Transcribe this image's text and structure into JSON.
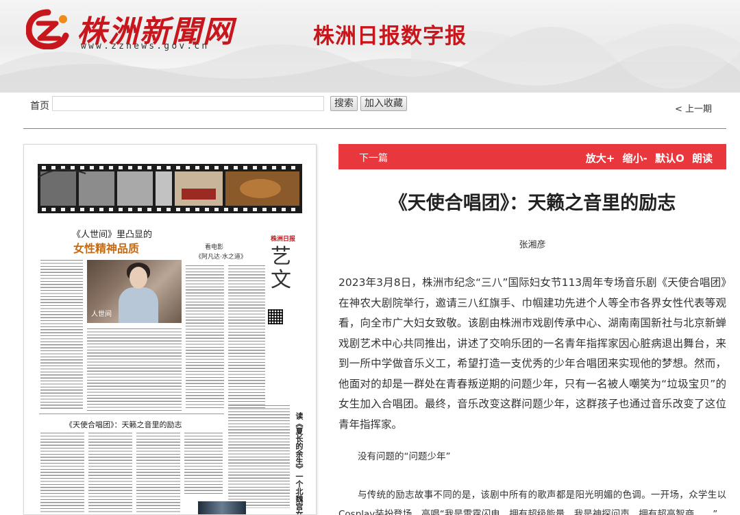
{
  "header": {
    "logo_text": "株洲新聞网",
    "logo_url": "www.zznews.gov.cn",
    "site_title": "株洲日报数字报",
    "colors": {
      "brand_red": "#c8161d",
      "accent_orange": "#f08a1c"
    }
  },
  "toolbar": {
    "home_label": "首页",
    "search_value": "",
    "search_button": "搜索",
    "favorite_button": "加入收藏",
    "prev_issue": "< 上一期"
  },
  "paper": {
    "headline_1": "《人世间》里凸显的",
    "headline_2": "女性精神品质",
    "photo_tag": "人世间",
    "masthead": "株洲日报",
    "section_title": "艺文",
    "sub_1": "看电影",
    "sub_2": "《阿凡达·水之道》",
    "headline_3": "《天使合唱团》：天籁之音里的励志",
    "vertical_title": "读《夏长的余生》一个北魏宫女和她的时代"
  },
  "article": {
    "bar_color": "#e8383d",
    "next_label": "下一篇",
    "tools": [
      "放大+",
      "缩小-",
      "默认O",
      "朗读"
    ],
    "title": "《天使合唱团》：天籁之音里的励志",
    "author": "张湘彦",
    "paragraph_1": "2023年3月8日，株洲市纪念“三八”国际妇女节113周年专场音乐剧《天使合唱团》在神农大剧院举行，邀请三八红旗手、巾帼建功先进个人等全市各界女性代表等观看，向全市广大妇女致敬。该剧由株洲市戏剧传承中心、湖南南国新社与北京新蝉戏剧艺术中心共同推出，讲述了交响乐团的一名青年指挥家因心脏病退出舞台，来到一所中学做音乐义工，希望打造一支优秀的少年合唱团来实现他的梦想。然而，他面对的却是一群处在青春叛逆期的问题少年，只有一名被人嘲笑为“垃圾宝贝”的女生加入合唱团。最终，音乐改变这群问题少年，这群孩子也通过音乐改变了这位青年指挥家。",
    "subheading": "没有问题的“问题少年”",
    "paragraph_2": "与传统的励志故事不同的是，该剧中所有的歌声都是阳光明媚的色调。一开场，众学生以Cosplay装扮登场，高唱“我是雷霆闪电，拥有超级能量，我是神探问声，拥有超高智商……”"
  }
}
